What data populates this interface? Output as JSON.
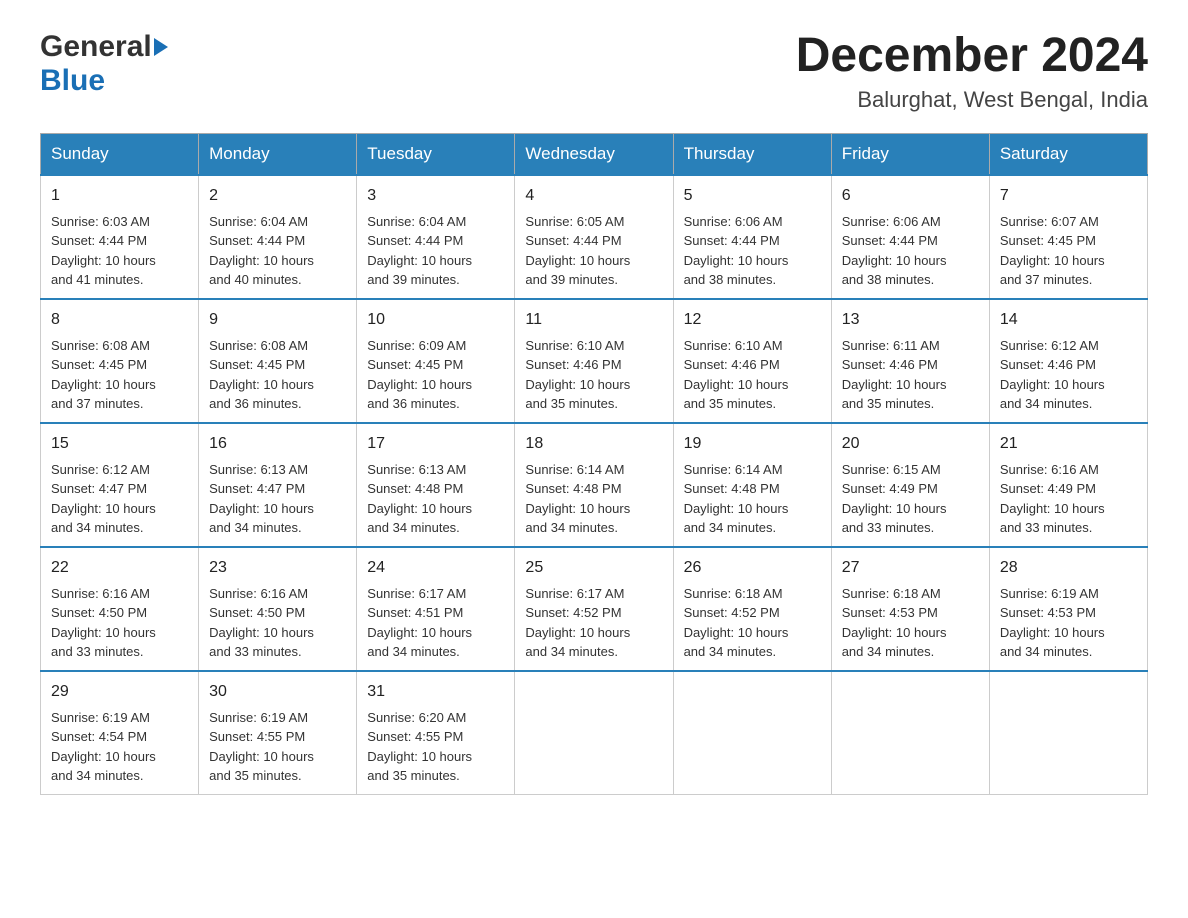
{
  "header": {
    "logo_general": "General",
    "logo_blue": "Blue",
    "month_year": "December 2024",
    "location": "Balurghat, West Bengal, India"
  },
  "days_of_week": [
    "Sunday",
    "Monday",
    "Tuesday",
    "Wednesday",
    "Thursday",
    "Friday",
    "Saturday"
  ],
  "weeks": [
    [
      {
        "day": "1",
        "sunrise": "6:03 AM",
        "sunset": "4:44 PM",
        "daylight": "10 hours and 41 minutes."
      },
      {
        "day": "2",
        "sunrise": "6:04 AM",
        "sunset": "4:44 PM",
        "daylight": "10 hours and 40 minutes."
      },
      {
        "day": "3",
        "sunrise": "6:04 AM",
        "sunset": "4:44 PM",
        "daylight": "10 hours and 39 minutes."
      },
      {
        "day": "4",
        "sunrise": "6:05 AM",
        "sunset": "4:44 PM",
        "daylight": "10 hours and 39 minutes."
      },
      {
        "day": "5",
        "sunrise": "6:06 AM",
        "sunset": "4:44 PM",
        "daylight": "10 hours and 38 minutes."
      },
      {
        "day": "6",
        "sunrise": "6:06 AM",
        "sunset": "4:44 PM",
        "daylight": "10 hours and 38 minutes."
      },
      {
        "day": "7",
        "sunrise": "6:07 AM",
        "sunset": "4:45 PM",
        "daylight": "10 hours and 37 minutes."
      }
    ],
    [
      {
        "day": "8",
        "sunrise": "6:08 AM",
        "sunset": "4:45 PM",
        "daylight": "10 hours and 37 minutes."
      },
      {
        "day": "9",
        "sunrise": "6:08 AM",
        "sunset": "4:45 PM",
        "daylight": "10 hours and 36 minutes."
      },
      {
        "day": "10",
        "sunrise": "6:09 AM",
        "sunset": "4:45 PM",
        "daylight": "10 hours and 36 minutes."
      },
      {
        "day": "11",
        "sunrise": "6:10 AM",
        "sunset": "4:46 PM",
        "daylight": "10 hours and 35 minutes."
      },
      {
        "day": "12",
        "sunrise": "6:10 AM",
        "sunset": "4:46 PM",
        "daylight": "10 hours and 35 minutes."
      },
      {
        "day": "13",
        "sunrise": "6:11 AM",
        "sunset": "4:46 PM",
        "daylight": "10 hours and 35 minutes."
      },
      {
        "day": "14",
        "sunrise": "6:12 AM",
        "sunset": "4:46 PM",
        "daylight": "10 hours and 34 minutes."
      }
    ],
    [
      {
        "day": "15",
        "sunrise": "6:12 AM",
        "sunset": "4:47 PM",
        "daylight": "10 hours and 34 minutes."
      },
      {
        "day": "16",
        "sunrise": "6:13 AM",
        "sunset": "4:47 PM",
        "daylight": "10 hours and 34 minutes."
      },
      {
        "day": "17",
        "sunrise": "6:13 AM",
        "sunset": "4:48 PM",
        "daylight": "10 hours and 34 minutes."
      },
      {
        "day": "18",
        "sunrise": "6:14 AM",
        "sunset": "4:48 PM",
        "daylight": "10 hours and 34 minutes."
      },
      {
        "day": "19",
        "sunrise": "6:14 AM",
        "sunset": "4:48 PM",
        "daylight": "10 hours and 34 minutes."
      },
      {
        "day": "20",
        "sunrise": "6:15 AM",
        "sunset": "4:49 PM",
        "daylight": "10 hours and 33 minutes."
      },
      {
        "day": "21",
        "sunrise": "6:16 AM",
        "sunset": "4:49 PM",
        "daylight": "10 hours and 33 minutes."
      }
    ],
    [
      {
        "day": "22",
        "sunrise": "6:16 AM",
        "sunset": "4:50 PM",
        "daylight": "10 hours and 33 minutes."
      },
      {
        "day": "23",
        "sunrise": "6:16 AM",
        "sunset": "4:50 PM",
        "daylight": "10 hours and 33 minutes."
      },
      {
        "day": "24",
        "sunrise": "6:17 AM",
        "sunset": "4:51 PM",
        "daylight": "10 hours and 34 minutes."
      },
      {
        "day": "25",
        "sunrise": "6:17 AM",
        "sunset": "4:52 PM",
        "daylight": "10 hours and 34 minutes."
      },
      {
        "day": "26",
        "sunrise": "6:18 AM",
        "sunset": "4:52 PM",
        "daylight": "10 hours and 34 minutes."
      },
      {
        "day": "27",
        "sunrise": "6:18 AM",
        "sunset": "4:53 PM",
        "daylight": "10 hours and 34 minutes."
      },
      {
        "day": "28",
        "sunrise": "6:19 AM",
        "sunset": "4:53 PM",
        "daylight": "10 hours and 34 minutes."
      }
    ],
    [
      {
        "day": "29",
        "sunrise": "6:19 AM",
        "sunset": "4:54 PM",
        "daylight": "10 hours and 34 minutes."
      },
      {
        "day": "30",
        "sunrise": "6:19 AM",
        "sunset": "4:55 PM",
        "daylight": "10 hours and 35 minutes."
      },
      {
        "day": "31",
        "sunrise": "6:20 AM",
        "sunset": "4:55 PM",
        "daylight": "10 hours and 35 minutes."
      },
      null,
      null,
      null,
      null
    ]
  ],
  "labels": {
    "sunrise": "Sunrise:",
    "sunset": "Sunset:",
    "daylight": "Daylight:"
  }
}
